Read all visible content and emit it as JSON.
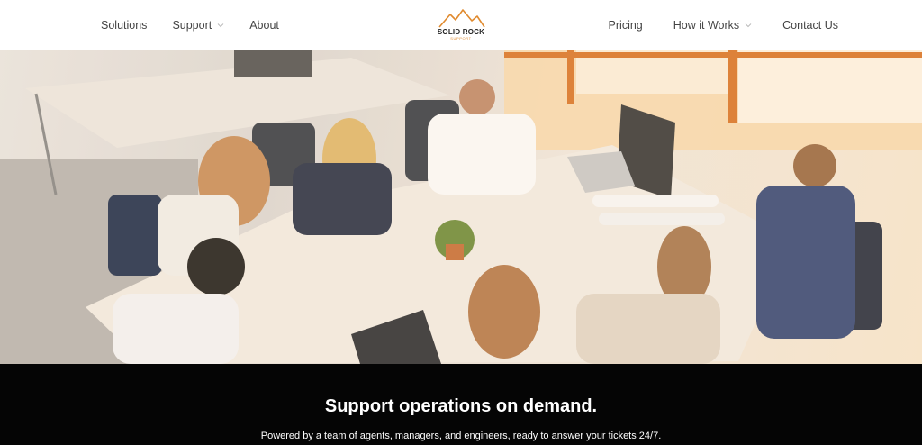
{
  "nav": {
    "left": [
      {
        "label": "Solutions",
        "has_dropdown": false
      },
      {
        "label": "Support",
        "has_dropdown": true
      },
      {
        "label": "About",
        "has_dropdown": false
      }
    ],
    "right": [
      {
        "label": "Pricing",
        "has_dropdown": false
      },
      {
        "label": "How it Works",
        "has_dropdown": true
      },
      {
        "label": "Contact Us",
        "has_dropdown": false
      }
    ]
  },
  "logo": {
    "name": "SOLID ROCK",
    "tagline": "SUPPORT",
    "icon": "mountain-icon",
    "accent": "#e08a2e"
  },
  "hero": {
    "image": "team-meeting-photo"
  },
  "banner": {
    "headline": "Support operations on demand.",
    "subline": "Powered by a team of agents, managers, and engineers, ready to answer your tickets 24/7."
  },
  "colors": {
    "band_background": "#050505",
    "nav_text": "#444444"
  }
}
